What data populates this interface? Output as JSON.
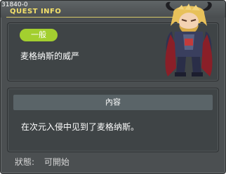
{
  "window": {
    "quest_id": "31840-0",
    "title": "QUEST INFO"
  },
  "quest": {
    "category": "一般",
    "name": "麦格纳斯的威严"
  },
  "content": {
    "header": "內容",
    "description": "在次元入侵中见到了麦格纳斯。"
  },
  "status": {
    "label": "狀態:",
    "value": "可開始"
  },
  "colors": {
    "window_bg": "#4b4f51",
    "title_text": "#f3e06a",
    "badge": "#a3cf2f",
    "panel_bg": "#3f4446",
    "section_header": "#5a6468"
  },
  "npc_portrait": "magnus-character-icon"
}
